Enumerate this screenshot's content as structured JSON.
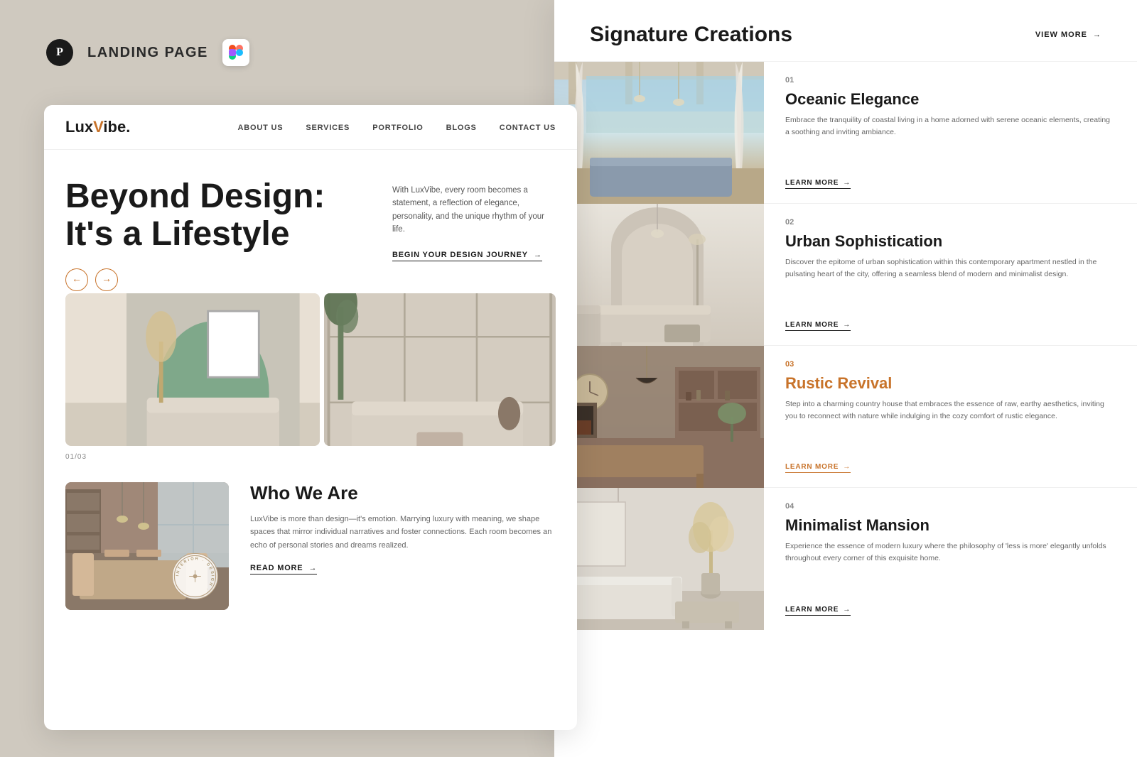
{
  "topbar": {
    "title": "LANDING PAGE",
    "logo_char": "P"
  },
  "brand": {
    "name_start": "Lux",
    "name_v": "V",
    "name_end": "ibe."
  },
  "nav": {
    "items": [
      {
        "label": "ABOUT US"
      },
      {
        "label": "SERVICES"
      },
      {
        "label": "PORTFOLIO"
      },
      {
        "label": "BLOGS"
      },
      {
        "label": "CONTACT US"
      }
    ]
  },
  "hero": {
    "title": "Beyond Design: It's a Lifestyle",
    "description": "With LuxVibe, every room becomes a statement, a reflection of elegance, personality, and the unique rhythm of your life.",
    "cta_label": "BEGIN YOUR DESIGN JOURNEY",
    "arrow": "→"
  },
  "slider": {
    "counter": "01/03",
    "prev_label": "←",
    "next_label": "→"
  },
  "who_we_are": {
    "title": "Who We Are",
    "description": "LuxVibe is more than design—it's emotion. Marrying luxury with meaning, we shape spaces that mirror individual narratives and foster connections. Each room becomes an echo of personal stories and dreams realized.",
    "cta_label": "READ MORE",
    "badge_text": "INTERIOR DESIGN",
    "arrow": "→"
  },
  "signature": {
    "title": "Signature Creations",
    "view_more_label": "VIEW MORE",
    "arrow": "→",
    "items": [
      {
        "number": "01",
        "name": "Oceanic Elegance",
        "description": "Embrace the tranquility of coastal living in a home adorned with serene oceanic elements, creating a soothing and inviting ambiance.",
        "cta": "LEARN MORE",
        "accent": false
      },
      {
        "number": "02",
        "name": "Urban Sophistication",
        "description": "Discover the epitome of urban sophistication within this contemporary apartment nestled in the pulsating heart of the city, offering a seamless blend of modern and minimalist design.",
        "cta": "LEARN MORE",
        "accent": false
      },
      {
        "number": "03",
        "name": "Rustic Revival",
        "description": "Step into a charming country house that embraces the essence of raw, earthy aesthetics, inviting you to reconnect with nature while indulging in the cozy comfort of rustic elegance.",
        "cta": "LEARN MORE",
        "accent": true
      },
      {
        "number": "04",
        "name": "Minimalist Mansion",
        "description": "Experience the essence of modern luxury where the philosophy of 'less is more' elegantly unfolds throughout every corner of this exquisite home.",
        "cta": "LEARN MORE",
        "accent": false
      }
    ]
  },
  "colors": {
    "accent": "#c8732a",
    "dark": "#1a1a1a",
    "bg": "#cfc9bf",
    "muted": "#888888"
  }
}
